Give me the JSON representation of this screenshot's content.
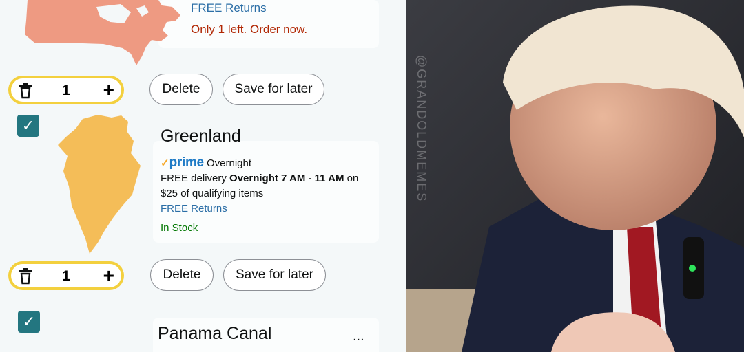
{
  "cart": {
    "item_canada": {
      "free_returns": "FREE Returns",
      "stock_warning": "Only 1 left. Order now."
    },
    "row1": {
      "quantity": "1",
      "delete_label": "Delete",
      "save_label": "Save for later"
    },
    "item_greenland": {
      "title": "Greenland",
      "prime_word": "prime",
      "prime_speed": "Overnight",
      "delivery_prefix": "FREE delivery ",
      "delivery_window": "Overnight 7 AM - 11 AM",
      "delivery_suffix": " on",
      "delivery_line2": "$25 of qualifying items",
      "free_returns": "FREE Returns",
      "stock": "In Stock"
    },
    "row2": {
      "quantity": "1",
      "delete_label": "Delete",
      "save_label": "Save for later"
    },
    "item_panama": {
      "title": "Panama Canal",
      "more": "..."
    }
  },
  "photo": {
    "watermark": "@GRANDOLDMEMES"
  },
  "colors": {
    "accent_yellow": "#f3d03e",
    "checkbox_teal": "#237680",
    "link_blue": "#2b6ea6",
    "warning_red": "#b12704",
    "stock_green": "#007600",
    "canada_fill": "#ee9a82",
    "greenland_fill": "#f4bd58"
  }
}
